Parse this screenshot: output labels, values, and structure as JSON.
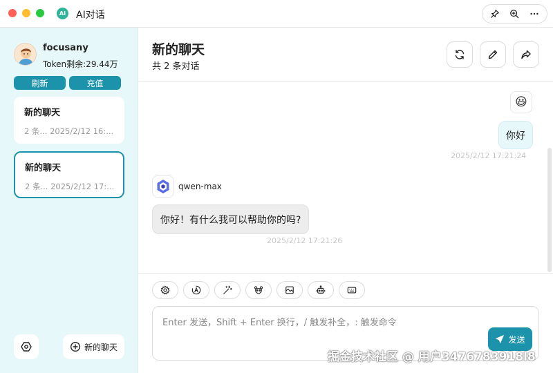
{
  "window": {
    "title": "AI对话",
    "logo_text": "AI"
  },
  "sidebar": {
    "username": "focusany",
    "token_text": "Token剩余:29.44万",
    "refresh_label": "刷新",
    "recharge_label": "充值",
    "chats": [
      {
        "title": "新的聊天",
        "meta": "2 条...  2025/2/12 16:..."
      },
      {
        "title": "新的聊天",
        "meta": "2 条...  2025/2/12 17:..."
      }
    ],
    "new_chat_label": "新的聊天"
  },
  "header": {
    "title": "新的聊天",
    "subtitle": "共 2 条对话"
  },
  "messages": {
    "user_avatar": "😃",
    "user_text": "你好",
    "user_time": "2025/2/12 17:21:24",
    "bot_name": "qwen-max",
    "bot_text": "你好！有什么我可以帮助你的吗?",
    "bot_time": "2025/2/12 17:21:26"
  },
  "composer": {
    "placeholder": "Enter 发送，Shift + Enter 换行，/ 触发补全，: 触发命令",
    "value": "",
    "send_label": "发送"
  },
  "watermark": "掘金技术社区 @ 用户3476783918l8",
  "icons": [
    "pin-icon",
    "zoom-icon",
    "more-icon",
    "refresh-icon",
    "edit-icon",
    "share-icon",
    "settings-icon",
    "plus-circle-icon",
    "send-icon",
    "gear-icon",
    "magic-wand-icon",
    "mask-icon",
    "image-icon",
    "robot-icon",
    "keyboard-icon"
  ],
  "colors": {
    "accent": "#1d93ab",
    "sidebar_bg": "#e7f8fb",
    "user_bubble": "#e7f8fb",
    "bot_bubble": "#ededed"
  }
}
